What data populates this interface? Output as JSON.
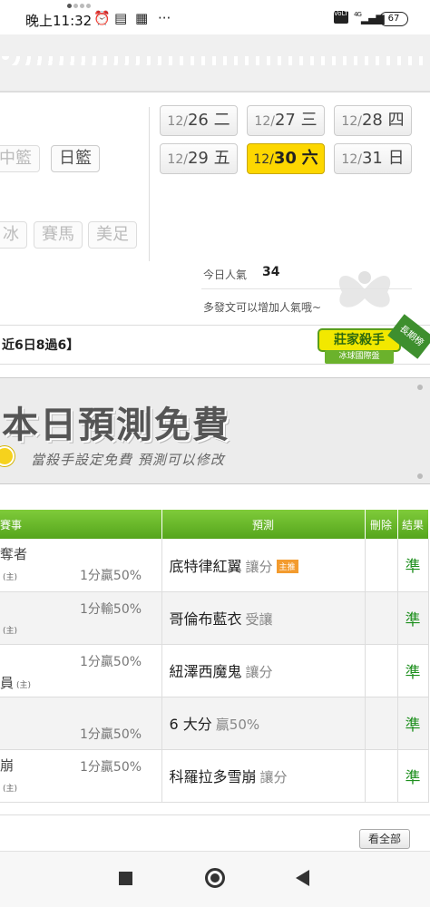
{
  "status_bar": {
    "time": "晚上11:32",
    "icons": [
      "alarm-icon",
      "notes-icon",
      "qr-icon",
      "more-icon"
    ],
    "signal_label": "VoLTE",
    "network": "4G",
    "battery": "67"
  },
  "sport_chips": [
    {
      "label": "中籃",
      "state": "disabled"
    },
    {
      "label": "日籃",
      "state": "enabled"
    },
    {
      "label": "冰",
      "state": "disabled"
    },
    {
      "label": "賽馬",
      "state": "disabled"
    },
    {
      "label": "美足",
      "state": "disabled"
    }
  ],
  "dates": [
    {
      "month": "12/",
      "day": "26",
      "weekday": "二",
      "active": false
    },
    {
      "month": "12/",
      "day": "27",
      "weekday": "三",
      "active": false
    },
    {
      "month": "12/",
      "day": "28",
      "weekday": "四",
      "active": false
    },
    {
      "month": "12/",
      "day": "29",
      "weekday": "五",
      "active": false
    },
    {
      "month": "12/",
      "day": "30",
      "weekday": "六",
      "active": true
    },
    {
      "month": "12/",
      "day": "31",
      "weekday": "日",
      "active": false
    }
  ],
  "popularity": {
    "label": "今日人氣",
    "value": "34",
    "hint": "多發文可以增加人氣哦~"
  },
  "record": {
    "text": "近6日8過6】",
    "badge_main": "莊家殺手",
    "badge_sub": "冰球國際盤",
    "ribbon": "長期榜"
  },
  "banner": {
    "title": "本日預測免費",
    "subtitle": "當殺手設定免費 預測可以修改"
  },
  "table": {
    "headers": [
      "賽事",
      "預測",
      "刪除",
      "結果"
    ],
    "rows": [
      {
        "team1": "奪者",
        "team2": "",
        "team2_home": "(主)",
        "handicap": "1分贏50%",
        "handicap_pos": "top",
        "prediction": "底特律紅翼",
        "pred_type": "讓分",
        "tag": "主推",
        "result": "準"
      },
      {
        "team1": "",
        "team2": "",
        "team2_home": "(主)",
        "handicap": "1分輸50%",
        "handicap_pos": "top",
        "prediction": "哥倫布藍衣",
        "pred_type": "受讓",
        "tag": "",
        "result": "準"
      },
      {
        "team1": "",
        "team2": "員",
        "team2_home": "(主)",
        "handicap": "1分贏50%",
        "handicap_pos": "top",
        "prediction": "紐澤西魔鬼",
        "pred_type": "讓分",
        "tag": "",
        "result": "準"
      },
      {
        "team1": "",
        "team2": "",
        "team2_home": "",
        "handicap": "1分贏50%",
        "handicap_pos": "bottom",
        "prediction": "6 大分",
        "pred_type": "贏50%",
        "tag": "",
        "result": "準"
      },
      {
        "team1": "崩",
        "team2": "",
        "team2_home": "(主)",
        "handicap": "1分贏50%",
        "handicap_pos": "top",
        "prediction": "科羅拉多雪崩",
        "pred_type": "讓分",
        "tag": "",
        "result": "準"
      }
    ]
  },
  "see_all": "看全部"
}
